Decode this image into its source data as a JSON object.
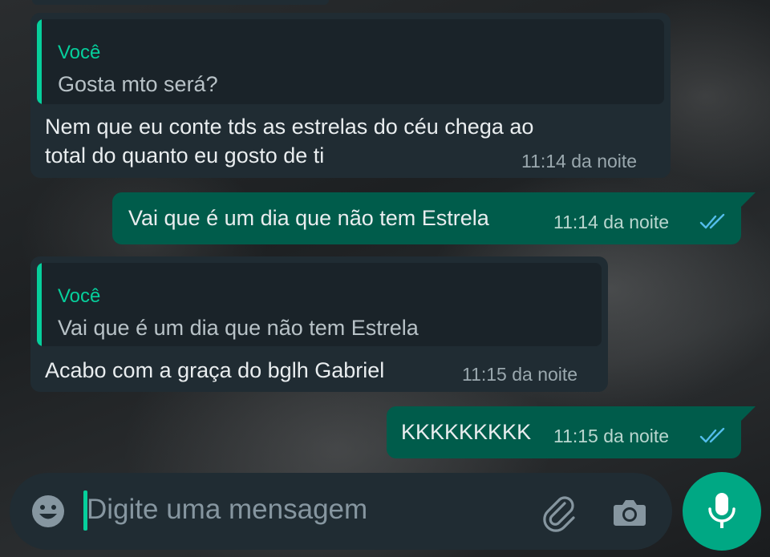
{
  "messages": [
    {
      "direction": "incoming",
      "quote": {
        "author": "Você",
        "text": "Gosta mto será?"
      },
      "lines": [
        "Nem que eu conte tds as estrelas do céu chega ao",
        "total do quanto eu gosto de ti"
      ],
      "time": "11:14 da noite"
    },
    {
      "direction": "outgoing",
      "text": "Vai que é um dia que não tem Estrela",
      "time": "11:14 da noite",
      "status": "read"
    },
    {
      "direction": "incoming",
      "quote": {
        "author": "Você",
        "text": "Vai que é um dia que não tem Estrela"
      },
      "text": "Acabo com a graça do bglh Gabriel",
      "time": "11:15 da noite"
    },
    {
      "direction": "outgoing",
      "text": "KKKKKKKKK",
      "time": "11:15 da noite",
      "status": "read"
    }
  ],
  "composer": {
    "placeholder": "Digite uma mensagem",
    "icons": [
      "emoji-icon",
      "paperclip-icon",
      "camera-icon",
      "microphone-icon"
    ]
  },
  "colors": {
    "incoming_bubble": "#202c33",
    "outgoing_bubble": "#005c4b",
    "accent": "#06cf9c",
    "mic_button": "#00a884",
    "read_ticks": "#53bdeb"
  }
}
